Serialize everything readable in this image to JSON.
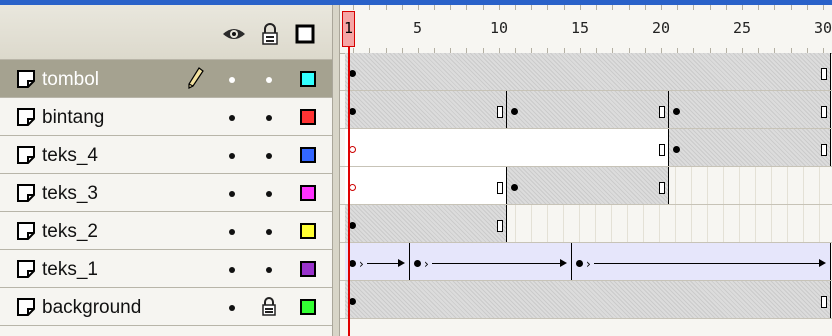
{
  "header": {
    "eye_icon": "eye-icon",
    "lock_icon": "lock-icon",
    "outline_icon": "outline-square-icon"
  },
  "ruler": {
    "labels": [
      "5",
      "10",
      "15",
      "20",
      "25",
      "30"
    ],
    "current_frame": "1"
  },
  "layers": [
    {
      "name": "tombol",
      "selected": true,
      "color": "#33ffff",
      "editing": true,
      "locked": false
    },
    {
      "name": "bintang",
      "selected": false,
      "color": "#ff3333",
      "locked": false
    },
    {
      "name": "teks_4",
      "selected": false,
      "color": "#3366ff",
      "locked": false
    },
    {
      "name": "teks_3",
      "selected": false,
      "color": "#ff33ff",
      "locked": false
    },
    {
      "name": "teks_2",
      "selected": false,
      "color": "#ffff33",
      "locked": false
    },
    {
      "name": "teks_1",
      "selected": false,
      "color": "#9933cc",
      "locked": false
    },
    {
      "name": "background",
      "selected": false,
      "color": "#33ff33",
      "locked": true
    }
  ],
  "timeline": {
    "playhead_frame": 1,
    "total_frames": 30
  }
}
